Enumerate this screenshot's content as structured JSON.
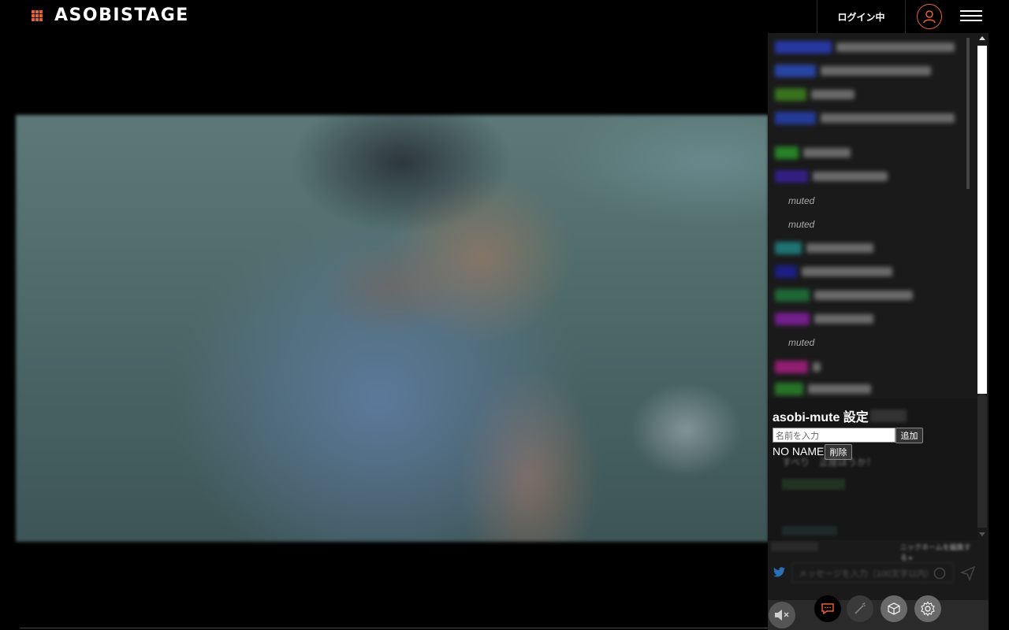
{
  "header": {
    "logo": "ASOBISTAGE",
    "login_status": "ログイン中"
  },
  "chat": {
    "muted_label": "muted",
    "ghost_line": "すべり　正座ほうか！"
  },
  "mute_settings": {
    "title": "asobi-mute 設定",
    "input_placeholder": "名前を入力",
    "add_label": "追加",
    "entries": [
      {
        "name": "NO NAME",
        "delete_label": "削除"
      }
    ]
  },
  "composer": {
    "nickname_edit": "ニックネームを編集する ▸",
    "message_placeholder": "メッセージを入力（100文字以内）"
  },
  "colors": {
    "accent": "#e8602a",
    "chat_name_colors": [
      "#2a3fc4",
      "#2c4fc7",
      "#3f8a1f",
      "#2742b8",
      "#2c9a2c",
      "#3a1fa0",
      "#1f8a8a",
      "#1d1f9e",
      "#1f7a3c",
      "#8a1fa8",
      "#b01f8a",
      "#2c8a2c"
    ]
  }
}
